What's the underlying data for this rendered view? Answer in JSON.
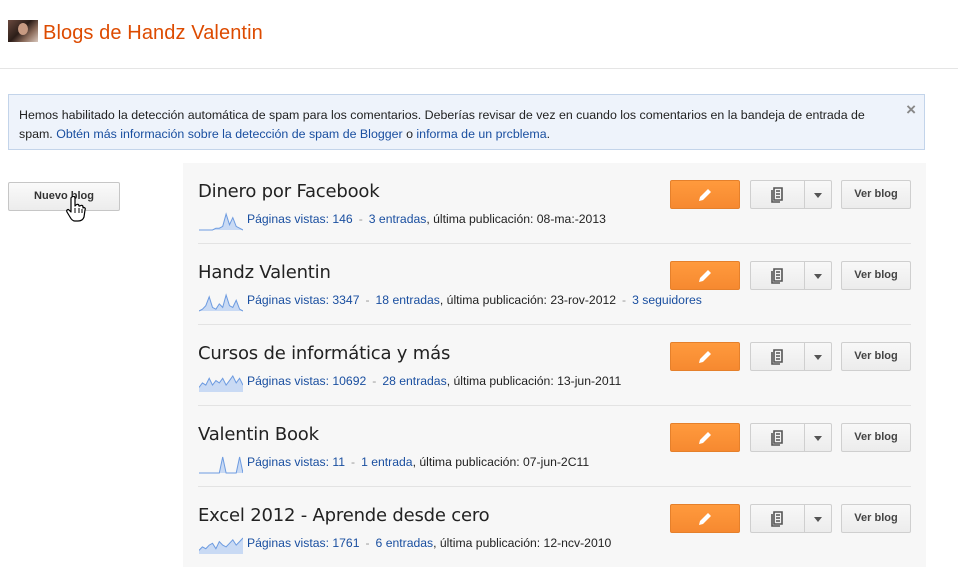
{
  "header": {
    "title": "Blogs de Handz Valentin"
  },
  "notice": {
    "text_1": "Hemos habilitado la detección automática de spam para los comentarios. Deberías revisar de vez en cuando los comentarios en la bandeja de entrada de spam. ",
    "link_1": "Obtén más información sobre la detección de spam de Blogger",
    "text_2": " o ",
    "link_2": "informa de un prcblema",
    "text_3": ".",
    "close": "×"
  },
  "sidebar": {
    "new_blog_label": "Nuevo blog"
  },
  "labels": {
    "view_blog": "Ver blog",
    "sep": "-"
  },
  "blogs": [
    {
      "name": "Dinero por Facebook",
      "pageviews": "Páginas vistas: 146",
      "posts": "3 entradas",
      "last_post": ", última publicación: 08-ma:-2013",
      "followers": "",
      "spark": [
        0,
        0,
        0,
        0,
        0,
        1,
        1,
        2,
        9,
        3,
        7,
        2,
        1,
        0
      ]
    },
    {
      "name": "Handz Valentin",
      "pageviews": "Páginas vistas: 3347",
      "posts": "18 entradas",
      "last_post": ", última publicación: 23-rov-2012",
      "followers": "3 seguidores",
      "spark": [
        0,
        1,
        3,
        8,
        2,
        1,
        4,
        2,
        9,
        3,
        2,
        6,
        1,
        0
      ]
    },
    {
      "name": "Cursos de informática y más",
      "pageviews": "Páginas vistas: 10692",
      "posts": "28 entradas",
      "last_post": ", última publicación: 13-jun-2011",
      "followers": "",
      "spark": [
        2,
        4,
        3,
        6,
        3,
        5,
        4,
        6,
        3,
        5,
        7,
        4,
        6,
        3
      ]
    },
    {
      "name": "Valentin Book",
      "pageviews": "Páginas vistas: 11",
      "posts": "1 entrada",
      "last_post": ", última publicación: 07-jun-2C11",
      "followers": "",
      "spark": [
        0,
        0,
        0,
        0,
        0,
        0,
        0,
        1,
        0,
        0,
        0,
        0,
        1,
        0
      ]
    },
    {
      "name": "Excel 2012 - Aprende desde cero",
      "pageviews": "Páginas vistas: 1761",
      "posts": "6 entradas",
      "last_post": ", última publicación: 12-ncv-2010",
      "followers": "",
      "spark": [
        2,
        4,
        3,
        5,
        6,
        3,
        7,
        5,
        4,
        6,
        8,
        5,
        7,
        9
      ]
    }
  ]
}
